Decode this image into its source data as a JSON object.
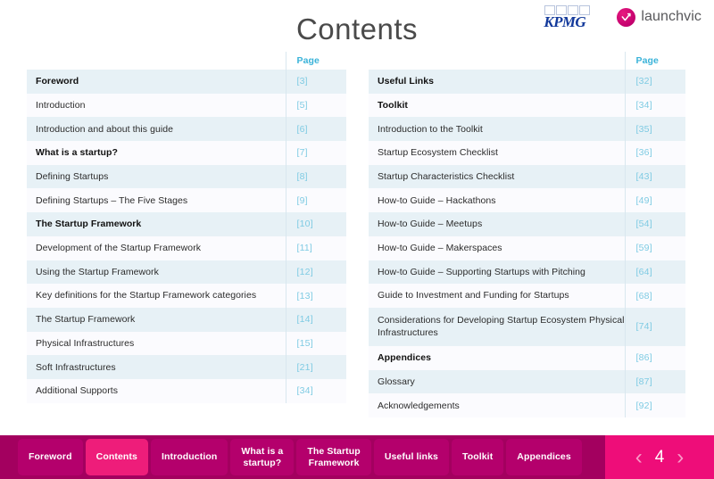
{
  "header": {
    "title": "Contents",
    "logos": {
      "kpmg": "KPMG",
      "launchvic": "launchvic"
    }
  },
  "toc": {
    "left": {
      "page_header": "Page",
      "rows": [
        {
          "title": "Foreword",
          "page": "[3]",
          "bold": true
        },
        {
          "title": "Introduction",
          "page": "[5]",
          "bold": false
        },
        {
          "title": "Introduction and about this guide",
          "page": "[6]",
          "bold": false
        },
        {
          "title": "What is a startup?",
          "page": "[7]",
          "bold": true
        },
        {
          "title": "Defining Startups",
          "page": "[8]",
          "bold": false
        },
        {
          "title": "Defining Startups – The Five Stages",
          "page": "[9]",
          "bold": false
        },
        {
          "title": "The Startup Framework",
          "page": "[10]",
          "bold": true
        },
        {
          "title": "Development of the Startup Framework",
          "page": "[11]",
          "bold": false
        },
        {
          "title": "Using the Startup Framework",
          "page": "[12]",
          "bold": false
        },
        {
          "title": "Key definitions for the Startup Framework categories",
          "page": "[13]",
          "bold": false
        },
        {
          "title": "The Startup Framework",
          "page": "[14]",
          "bold": false
        },
        {
          "title": "Physical Infrastructures",
          "page": "[15]",
          "bold": false
        },
        {
          "title": "Soft Infrastructures",
          "page": "[21]",
          "bold": false
        },
        {
          "title": "Additional Supports",
          "page": "[34]",
          "bold": false
        }
      ]
    },
    "right": {
      "page_header": "Page",
      "rows": [
        {
          "title": "Useful Links",
          "page": "[32]",
          "bold": true
        },
        {
          "title": "Toolkit",
          "page": "[34]",
          "bold": true
        },
        {
          "title": "Introduction to the Toolkit",
          "page": "[35]",
          "bold": false
        },
        {
          "title": "Startup Ecosystem Checklist",
          "page": "[36]",
          "bold": false
        },
        {
          "title": "Startup Characteristics Checklist",
          "page": "[43]",
          "bold": false
        },
        {
          "title": "How-to Guide – Hackathons",
          "page": "[49]",
          "bold": false
        },
        {
          "title": "How-to Guide – Meetups",
          "page": "[54]",
          "bold": false
        },
        {
          "title": "How-to Guide – Makerspaces",
          "page": "[59]",
          "bold": false
        },
        {
          "title": "How-to Guide – Supporting Startups with Pitching",
          "page": "[64]",
          "bold": false
        },
        {
          "title": "Guide to Investment and Funding for Startups",
          "page": "[68]",
          "bold": false
        },
        {
          "title": "Considerations for Developing Startup Ecosystem Physical Infrastructures",
          "page": "[74]",
          "bold": false,
          "tall": true
        },
        {
          "title": "Appendices",
          "page": "[86]",
          "bold": true
        },
        {
          "title": "Glossary",
          "page": "[87]",
          "bold": false
        },
        {
          "title": "Acknowledgements",
          "page": "[92]",
          "bold": false
        }
      ]
    }
  },
  "navbar": {
    "tabs": [
      {
        "label": "Foreword",
        "active": false
      },
      {
        "label": "Contents",
        "active": true
      },
      {
        "label": "Introduction",
        "active": false
      },
      {
        "label": "What is a\nstartup?",
        "active": false
      },
      {
        "label": "The Startup\nFramework",
        "active": false
      },
      {
        "label": "Useful links",
        "active": false
      },
      {
        "label": "Toolkit",
        "active": false
      },
      {
        "label": "Appendices",
        "active": false
      }
    ],
    "pager": {
      "prev_icon": "‹",
      "page_number": "4",
      "next_icon": "›"
    }
  },
  "colors": {
    "brand_pink": "#ee0d79",
    "brand_maroon": "#a3005f",
    "tab_inactive": "#b4006c",
    "row_blue": "#e7f1f6",
    "row_lavender": "#fbfbfe",
    "page_number_blue": "#7fcbe3",
    "page_header_blue": "#3ab3d9",
    "kpmg_blue": "#12399b"
  }
}
